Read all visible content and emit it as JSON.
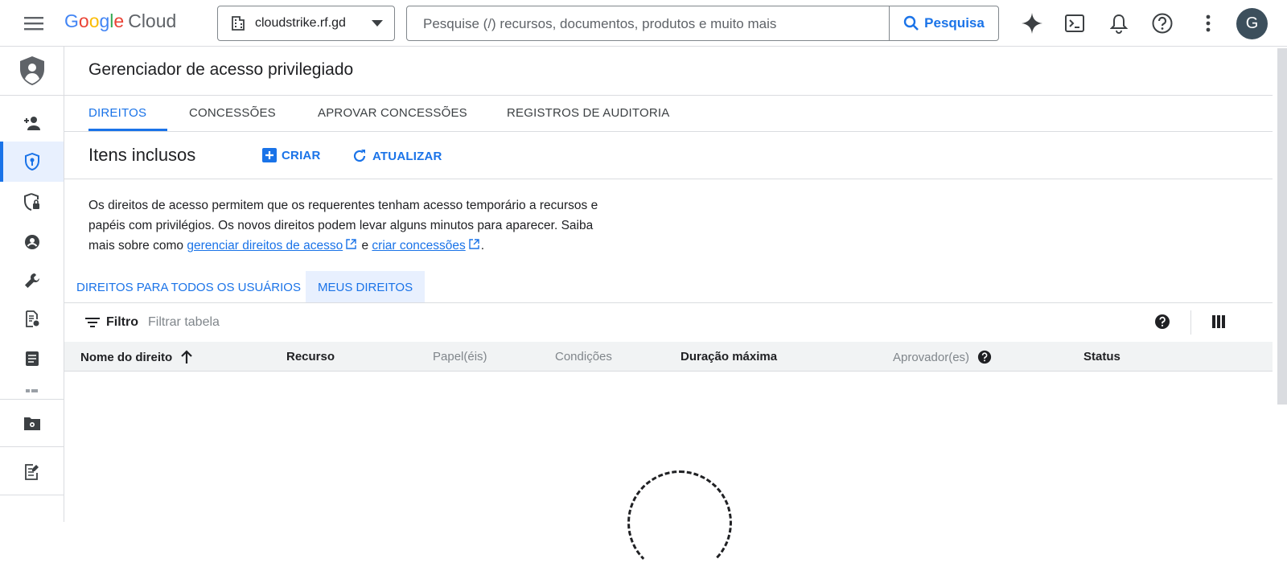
{
  "header": {
    "logo_google": "Google",
    "logo_cloud": "Cloud",
    "project_name": "cloudstrike.rf.gd",
    "search_placeholder": "Pesquise (/) recursos, documentos, produtos e muito mais",
    "search_button": "Pesquisa",
    "avatar_letter": "G"
  },
  "sidebar": {
    "icons": [
      "shield-person-icon",
      "person-add-icon",
      "shield-icon",
      "shield-lock-icon",
      "account-circle-icon",
      "wrench-icon",
      "policy-doc-icon",
      "document-icon",
      "partial-icon",
      "folder-gear-icon",
      "doc-edit-icon"
    ],
    "active_index": 2
  },
  "page": {
    "title": "Gerenciador de acesso privilegiado",
    "tabs": [
      {
        "label": "DIREITOS",
        "active": true
      },
      {
        "label": "CONCESSÕES",
        "active": false
      },
      {
        "label": "APROVAR CONCESSÕES",
        "active": false
      },
      {
        "label": "REGISTROS DE AUDITORIA",
        "active": false
      }
    ],
    "section_title": "Itens inclusos",
    "create_label": "CRIAR",
    "refresh_label": "ATUALIZAR",
    "description_1": "Os direitos de acesso permitem que os requerentes tenham acesso temporário a recursos e papéis com privilégios. Os novos direitos podem levar alguns minutos para aparecer. Saiba mais sobre como ",
    "description_link1": "gerenciar direitos de acesso",
    "description_mid": " e ",
    "description_link2": "criar concessões",
    "description_end": ".",
    "subtabs": [
      {
        "label": "DIREITOS PARA TODOS OS USUÁRIOS",
        "active": false
      },
      {
        "label": "MEUS DIREITOS",
        "active": true
      }
    ],
    "filter_label": "Filtro",
    "filter_placeholder": "Filtrar tabela",
    "columns": [
      {
        "label": "Nome do direito",
        "sortable": true
      },
      {
        "label": "Recurso"
      },
      {
        "label": "Papel(éis)"
      },
      {
        "label": "Condições"
      },
      {
        "label": "Duração máxima"
      },
      {
        "label": "Aprovador(es)"
      },
      {
        "label": "Status"
      }
    ]
  },
  "colors": {
    "accent": "#1a73e8",
    "active_bg": "#e8f0fe"
  }
}
